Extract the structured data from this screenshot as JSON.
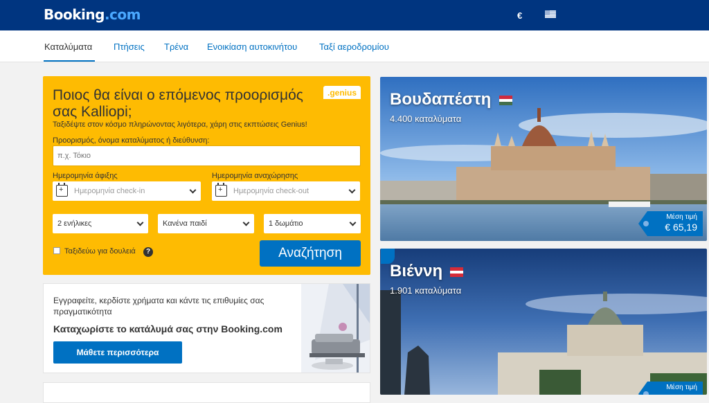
{
  "header": {
    "logo_main": "Booking",
    "logo_suffix": ".com",
    "currency": "€",
    "language_icon": "greek-flag-icon"
  },
  "nav": {
    "tabs": [
      {
        "label": "Καταλύματα",
        "active": true
      },
      {
        "label": "Πτήσεις",
        "active": false
      },
      {
        "label": "Τρένα",
        "active": false
      },
      {
        "label": "Ενοικίαση αυτοκινήτου",
        "active": false
      },
      {
        "label": "Ταξί αεροδρομίου",
        "active": false
      }
    ]
  },
  "search": {
    "title": "Ποιος θα είναι ο επόμενος προορισμός σας Kalliopi;",
    "genius_badge": ".genius",
    "subtitle": "Ταξιδέψτε στον κόσμο πληρώνοντας λιγότερα, χάρη στις εκπτώσεις Genius!",
    "destination_label": "Προορισμός, όνομα καταλύματος ή διεύθυνση:",
    "destination_placeholder": "π.χ. Τόκιο",
    "checkin_label": "Ημερομηνία άφιξης",
    "checkin_placeholder": "Ημερομηνία check-in",
    "checkout_label": "Ημερομηνία αναχώρησης",
    "checkout_placeholder": "Ημερομηνία check-out",
    "adults": "2 ενήλικες",
    "children": "Κανένα παιδί",
    "rooms": "1 δωμάτιο",
    "business_label": "Ταξιδεύω για δουλειά",
    "business_checked": false,
    "help_icon": "?",
    "search_button": "Αναζήτηση"
  },
  "promo": {
    "text": "Εγγραφείτε, κερδίστε χρήματα και κάντε τις επιθυμίες σας πραγματικότητα",
    "title": "Καταχωρίστε το κατάλυμά σας στην Booking.com",
    "button": "Μάθετε περισσότερα"
  },
  "destinations": [
    {
      "name": "Βουδαπέστη",
      "count": "4.400 καταλύματα",
      "price_label": "Μέση τιμή",
      "price": "€ 65,19"
    },
    {
      "name": "Βιέννη",
      "count": "1.901 καταλύματα",
      "price_label": "Μέση τιμή",
      "price": ""
    }
  ],
  "colors": {
    "brand": "#003580",
    "accent": "#febb02",
    "link": "#0071c2"
  }
}
